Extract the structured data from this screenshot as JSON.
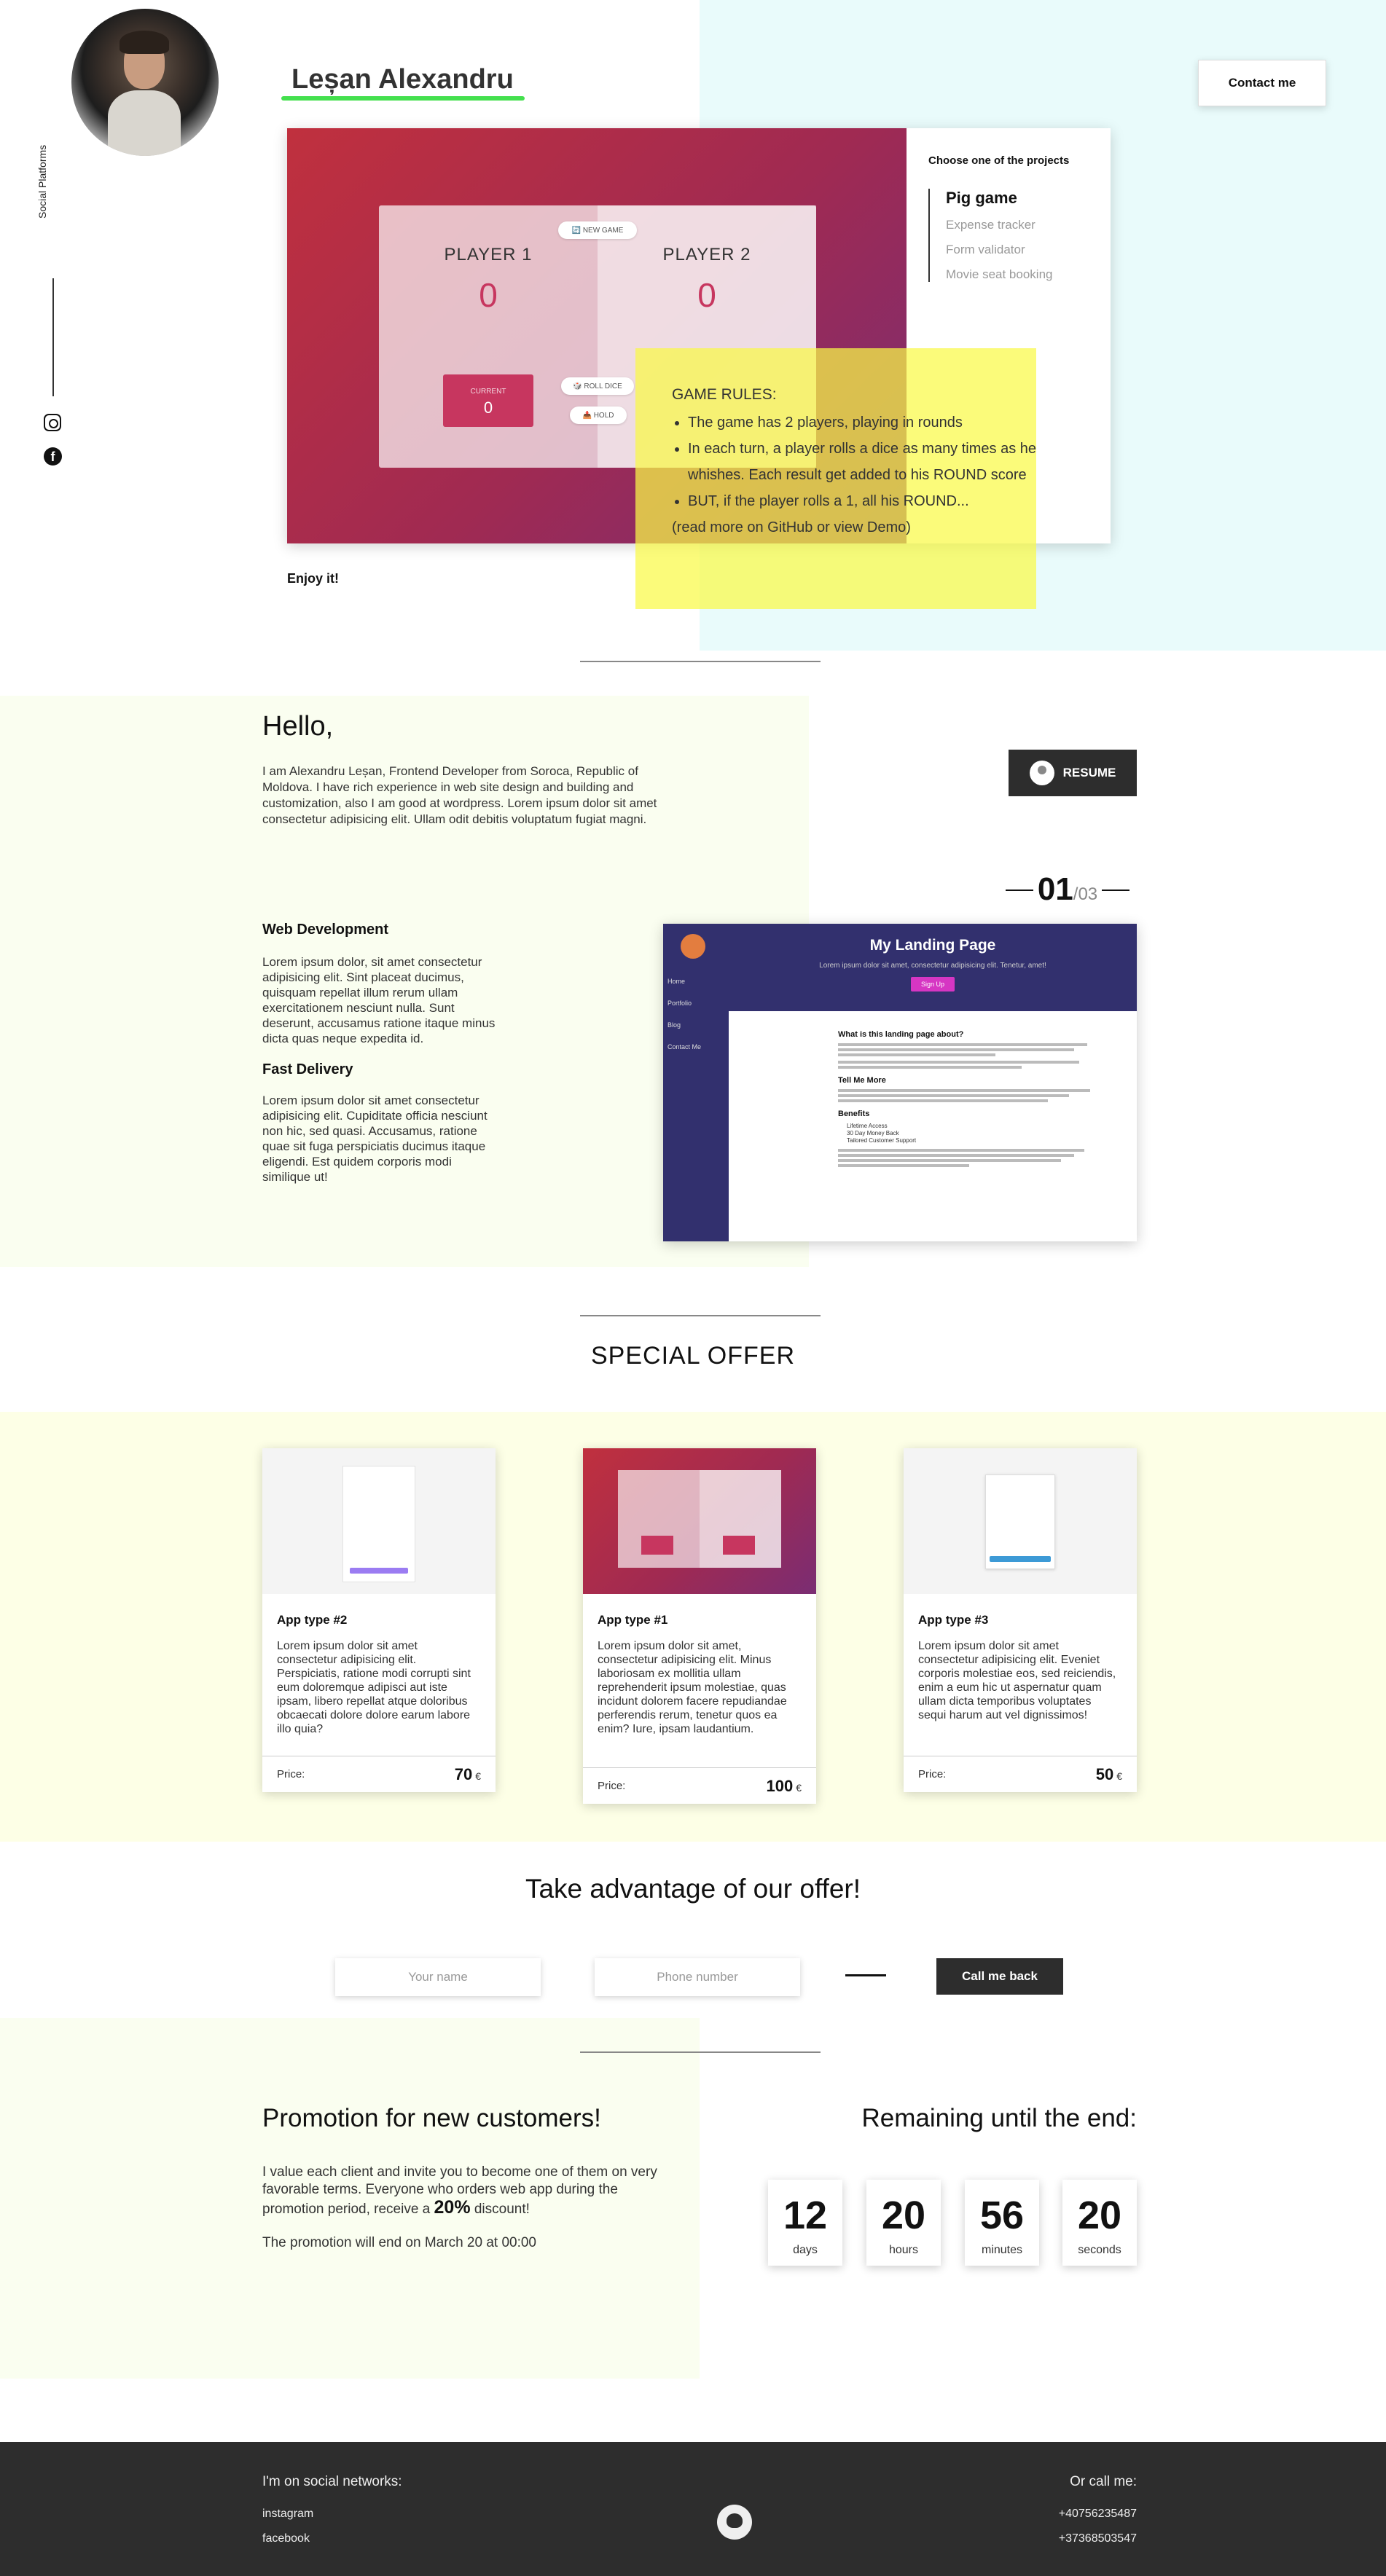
{
  "header": {
    "name": "Leșan Alexandru",
    "contact_label": "Contact me",
    "social_label": "Social Platforms"
  },
  "projects": {
    "heading": "Choose one of the projects",
    "items": [
      {
        "label": "Pig game"
      },
      {
        "label": "Expense tracker"
      },
      {
        "label": "Form validator"
      },
      {
        "label": "Movie seat booking"
      }
    ],
    "preview": {
      "new_game": "🔄 NEW GAME",
      "player1": "PLAYER 1",
      "player2": "PLAYER 2",
      "score1": "0",
      "score2": "0",
      "current_label": "CURRENT",
      "current_value": "0",
      "roll_dice": "🎲 ROLL DICE",
      "hold": "📥 HOLD"
    },
    "rules": {
      "title": "GAME RULES:",
      "items": [
        "The game has 2 players, playing in rounds",
        "In each turn, a player rolls a dice as many times as he whishes. Each result get added to his ROUND score",
        "BUT, if the player rolls a 1, all his ROUND..."
      ],
      "more": "(read more on GitHub or view Demo)"
    },
    "caption": "Enjoy it!"
  },
  "about": {
    "title": "Hello,",
    "intro": "I am Alexandru Leșan, Frontend Developer from Soroca, Republic of Moldova. I have rich experience in web site design and building and customization, also I am good at wordpress. Lorem ipsum dolor sit amet consectetur adipisicing elit. Ullam odit debitis voluptatum fugiat magni.",
    "resume_label": "RESUME",
    "counter_current": "01",
    "counter_total": "/03",
    "services": [
      {
        "title": "Web Development",
        "text": "Lorem ipsum dolor, sit amet consectetur adipisicing elit. Sint placeat ducimus, quisquam repellat illum rerum ullam exercitationem nesciunt nulla. Sunt deserunt, accusamus ratione itaque minus dicta quas neque expedita id."
      },
      {
        "title": "Fast Delivery",
        "text": "Lorem ipsum dolor sit amet consectetur adipisicing elit. Cupiditate officia nesciunt non hic, sed quasi. Accusamus, ratione quae sit fuga perspiciatis ducimus itaque eligendi. Est quidem corporis modi similique ut!"
      }
    ],
    "landing": {
      "title": "My Landing Page",
      "subtitle": "Lorem ipsum dolor sit amet, consectetur adipisicing elit. Tenetur, amet!",
      "signup": "Sign Up",
      "nav": [
        "Home",
        "Portfolio",
        "Blog",
        "Contact Me"
      ],
      "h1": "What is this landing page about?",
      "h2": "Tell Me More",
      "h3": "Benefits",
      "benefits": [
        "Lifetime Access",
        "30 Day Money Back",
        "Tailored Customer Support"
      ]
    }
  },
  "offer": {
    "title": "SPECIAL OFFER",
    "price_label": "Price:",
    "currency": "€",
    "cards": [
      {
        "title": "App type #2",
        "text": "Lorem ipsum dolor sit amet consectetur adipisicing elit. Perspiciatis, ratione modi corrupti sint eum doloremque adipisci aut iste ipsam, libero repellat atque doloribus obcaecati dolore dolore earum labore illo quia?",
        "price": "70"
      },
      {
        "title": "App type #1",
        "text": "Lorem ipsum dolor sit amet, consectetur adipisicing elit. Minus laboriosam ex mollitia ullam reprehenderit ipsum molestiae, quas incidunt dolorem facere repudiandae perferendis rerum, tenetur quos ea enim? Iure, ipsam laudantium.",
        "price": "100"
      },
      {
        "title": "App type #3",
        "text": "Lorem ipsum dolor sit amet consectetur adipisicing elit. Eveniet corporis molestiae eos, sed reiciendis, enim a eum hic ut aspernatur quam ullam dicta temporibus voluptates sequi harum aut vel dignissimos!",
        "price": "50"
      }
    ]
  },
  "cta": {
    "title": "Take advantage of our offer!",
    "name_placeholder": "Your name",
    "phone_placeholder": "Phone number",
    "button": "Call me back"
  },
  "promo": {
    "title": "Promotion for new customers!",
    "text_before": "I value each client and invite you to become one of them on very favorable terms. Everyone who orders web app during the promotion period, receive a ",
    "discount": "20%",
    "text_after": " discount!",
    "end": "The promotion will end on March 20 at 00:00",
    "remaining_title": "Remaining until the end:",
    "timer": [
      {
        "value": "12",
        "unit": "days"
      },
      {
        "value": "20",
        "unit": "hours"
      },
      {
        "value": "56",
        "unit": "minutes"
      },
      {
        "value": "20",
        "unit": "seconds"
      }
    ]
  },
  "footer": {
    "social_title": "I'm on social networks:",
    "links": [
      "instagram",
      "facebook"
    ],
    "call_title": "Or call me:",
    "phones": [
      "+40756235487",
      "+37368503547"
    ]
  }
}
